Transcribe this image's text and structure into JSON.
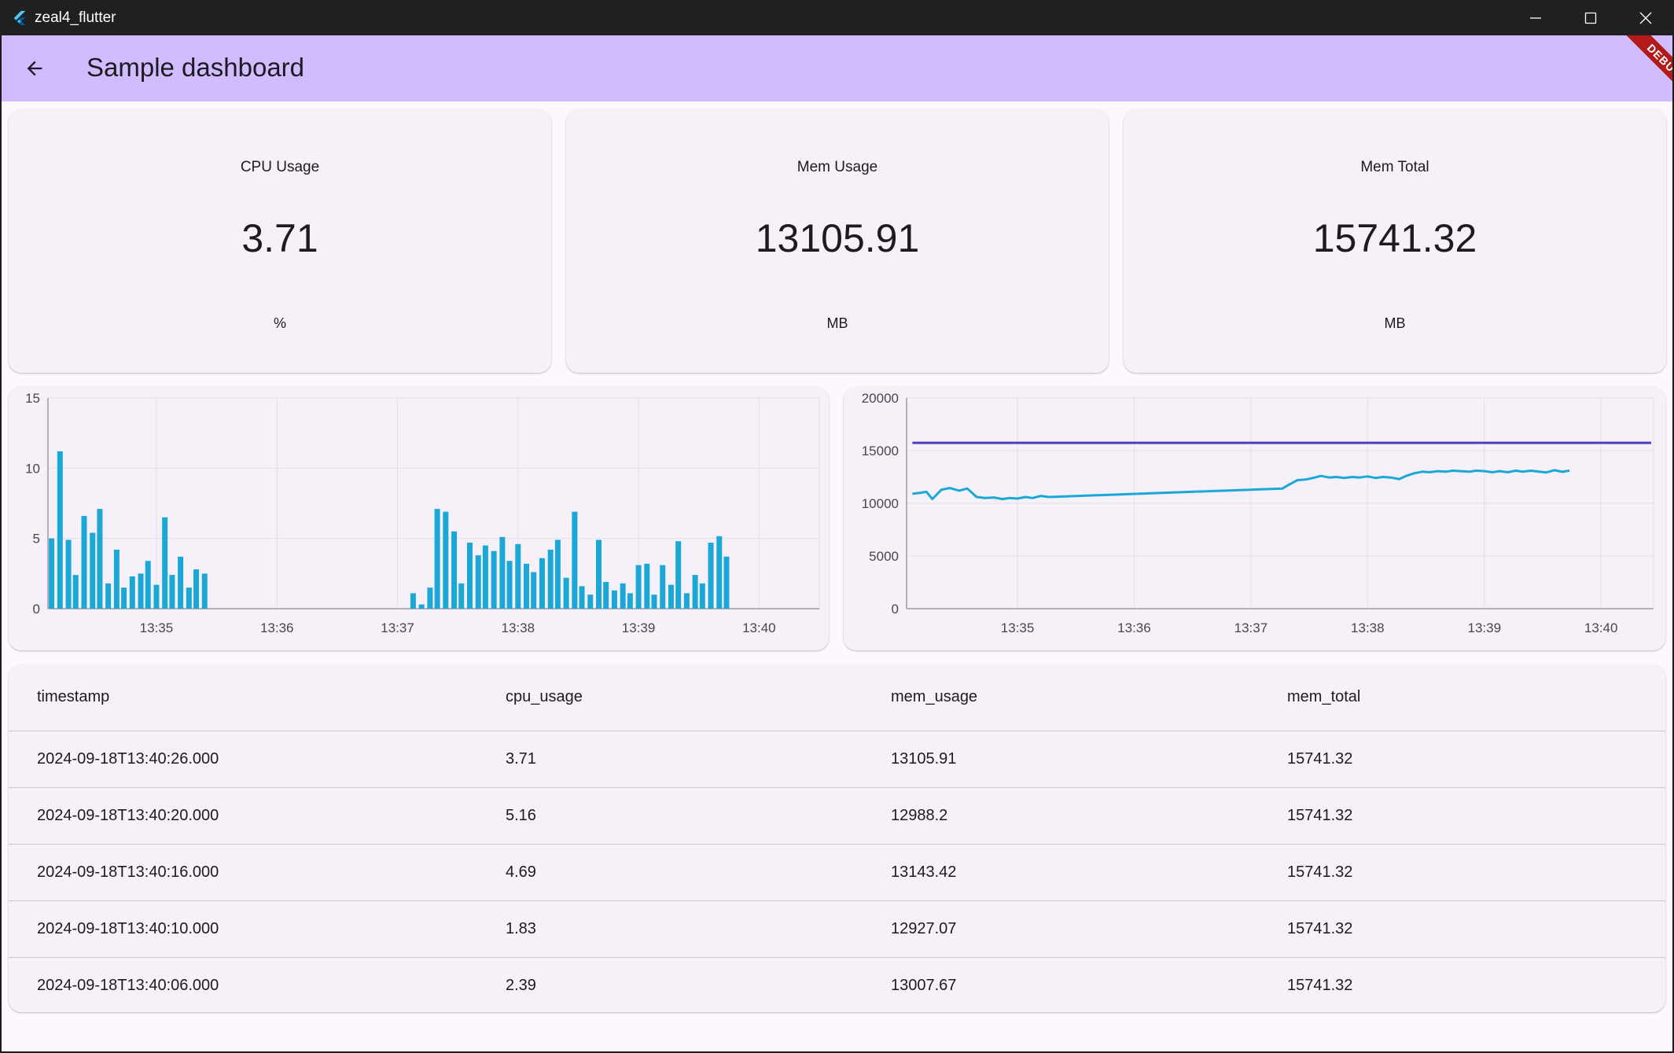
{
  "window": {
    "title": "zeal4_flutter"
  },
  "appbar": {
    "title": "Sample dashboard",
    "debug_banner": "DEBUG"
  },
  "metrics": [
    {
      "label": "CPU Usage",
      "value": "3.71",
      "unit": "%"
    },
    {
      "label": "Mem Usage",
      "value": "13105.91",
      "unit": "MB"
    },
    {
      "label": "Mem Total",
      "value": "15741.32",
      "unit": "MB"
    }
  ],
  "colors": {
    "appbar": "#d1bcff",
    "cpu_bar": "#1ba8d6",
    "mem_usage_line": "#1ba8d6",
    "mem_total_line": "#4a3fb8"
  },
  "chart_data": [
    {
      "type": "bar",
      "x_unit": "minutes",
      "x_range": [
        34.1,
        40.5
      ],
      "ylim": [
        0,
        15
      ],
      "yticks": [
        0,
        5,
        10,
        15
      ],
      "xticks": [
        {
          "label": "13:35",
          "x": 35
        },
        {
          "label": "13:36",
          "x": 36
        },
        {
          "label": "13:37",
          "x": 37
        },
        {
          "label": "13:38",
          "x": 38
        },
        {
          "label": "13:39",
          "x": 39
        },
        {
          "label": "13:40",
          "x": 40
        }
      ],
      "grid": true,
      "points": [
        [
          34.13,
          5.0
        ],
        [
          34.2,
          11.2
        ],
        [
          34.27,
          4.9
        ],
        [
          34.33,
          2.4
        ],
        [
          34.4,
          6.6
        ],
        [
          34.47,
          5.4
        ],
        [
          34.53,
          7.1
        ],
        [
          34.6,
          1.8
        ],
        [
          34.67,
          4.2
        ],
        [
          34.73,
          1.5
        ],
        [
          34.8,
          2.3
        ],
        [
          34.87,
          2.5
        ],
        [
          34.93,
          3.4
        ],
        [
          35.0,
          1.7
        ],
        [
          35.07,
          6.5
        ],
        [
          35.13,
          2.4
        ],
        [
          35.2,
          3.7
        ],
        [
          35.27,
          1.5
        ],
        [
          35.33,
          2.8
        ],
        [
          35.4,
          2.5
        ],
        [
          37.13,
          1.1
        ],
        [
          37.2,
          0.3
        ],
        [
          37.27,
          1.5
        ],
        [
          37.33,
          7.1
        ],
        [
          37.4,
          6.9
        ],
        [
          37.47,
          5.5
        ],
        [
          37.53,
          1.8
        ],
        [
          37.6,
          4.7
        ],
        [
          37.67,
          3.8
        ],
        [
          37.73,
          4.5
        ],
        [
          37.8,
          4.1
        ],
        [
          37.87,
          5.1
        ],
        [
          37.93,
          3.4
        ],
        [
          38.0,
          4.6
        ],
        [
          38.07,
          3.2
        ],
        [
          38.13,
          2.6
        ],
        [
          38.2,
          3.6
        ],
        [
          38.27,
          4.2
        ],
        [
          38.33,
          4.9
        ],
        [
          38.4,
          2.2
        ],
        [
          38.47,
          6.9
        ],
        [
          38.53,
          1.6
        ],
        [
          38.6,
          1.0
        ],
        [
          38.67,
          4.9
        ],
        [
          38.73,
          1.9
        ],
        [
          38.8,
          1.3
        ],
        [
          38.87,
          1.8
        ],
        [
          38.93,
          1.1
        ],
        [
          39.0,
          3.1
        ],
        [
          39.07,
          3.2
        ],
        [
          39.13,
          1.0
        ],
        [
          39.2,
          3.1
        ],
        [
          39.27,
          1.7
        ],
        [
          39.33,
          4.8
        ],
        [
          39.4,
          1.1
        ],
        [
          39.47,
          2.4
        ],
        [
          39.53,
          1.8
        ],
        [
          39.6,
          4.7
        ],
        [
          39.67,
          5.16
        ],
        [
          39.73,
          3.71
        ]
      ]
    },
    {
      "type": "line",
      "x_unit": "minutes",
      "x_range": [
        34.05,
        40.45
      ],
      "ylim": [
        0,
        20000
      ],
      "yticks": [
        0,
        5000,
        10000,
        15000,
        20000
      ],
      "xticks": [
        {
          "label": "13:35",
          "x": 35
        },
        {
          "label": "13:36",
          "x": 36
        },
        {
          "label": "13:37",
          "x": 37
        },
        {
          "label": "13:38",
          "x": 38
        },
        {
          "label": "13:39",
          "x": 39
        },
        {
          "label": "13:40",
          "x": 40
        }
      ],
      "grid": true,
      "series": [
        {
          "key": "mem_total",
          "points": [
            [
              34.1,
              15741.32
            ],
            [
              40.43,
              15741.32
            ]
          ]
        },
        {
          "key": "mem_usage",
          "points": [
            [
              34.1,
              10900
            ],
            [
              34.17,
              11000
            ],
            [
              34.22,
              11100
            ],
            [
              34.27,
              10400
            ],
            [
              34.35,
              11300
            ],
            [
              34.42,
              11450
            ],
            [
              34.5,
              11200
            ],
            [
              34.57,
              11400
            ],
            [
              34.65,
              10600
            ],
            [
              34.72,
              10500
            ],
            [
              34.8,
              10550
            ],
            [
              34.87,
              10400
            ],
            [
              34.93,
              10500
            ],
            [
              35.0,
              10450
            ],
            [
              35.07,
              10600
            ],
            [
              35.13,
              10500
            ],
            [
              35.2,
              10700
            ],
            [
              35.27,
              10600
            ],
            [
              37.27,
              11400
            ],
            [
              37.33,
              11800
            ],
            [
              37.4,
              12200
            ],
            [
              37.47,
              12250
            ],
            [
              37.53,
              12400
            ],
            [
              37.6,
              12600
            ],
            [
              37.67,
              12450
            ],
            [
              37.73,
              12500
            ],
            [
              37.8,
              12400
            ],
            [
              37.87,
              12500
            ],
            [
              37.93,
              12450
            ],
            [
              38.0,
              12550
            ],
            [
              38.07,
              12400
            ],
            [
              38.13,
              12500
            ],
            [
              38.2,
              12450
            ],
            [
              38.27,
              12300
            ],
            [
              38.33,
              12600
            ],
            [
              38.4,
              12850
            ],
            [
              38.47,
              13000
            ],
            [
              38.53,
              12950
            ],
            [
              38.6,
              13050
            ],
            [
              38.67,
              13000
            ],
            [
              38.73,
              13100
            ],
            [
              38.8,
              13050
            ],
            [
              38.87,
              13000
            ],
            [
              38.93,
              13100
            ],
            [
              39.0,
              13050
            ],
            [
              39.07,
              12950
            ],
            [
              39.13,
              13050
            ],
            [
              39.2,
              12950
            ],
            [
              39.27,
              13100
            ],
            [
              39.33,
              13000
            ],
            [
              39.4,
              13100
            ],
            [
              39.47,
              13007.67
            ],
            [
              39.53,
              12927.07
            ],
            [
              39.6,
              13143.42
            ],
            [
              39.67,
              12988.2
            ],
            [
              39.73,
              13105.91
            ]
          ]
        }
      ]
    }
  ],
  "table": {
    "columns": [
      "timestamp",
      "cpu_usage",
      "mem_usage",
      "mem_total"
    ],
    "rows": [
      [
        "2024-09-18T13:40:26.000",
        "3.71",
        "13105.91",
        "15741.32"
      ],
      [
        "2024-09-18T13:40:20.000",
        "5.16",
        "12988.2",
        "15741.32"
      ],
      [
        "2024-09-18T13:40:16.000",
        "4.69",
        "13143.42",
        "15741.32"
      ],
      [
        "2024-09-18T13:40:10.000",
        "1.83",
        "12927.07",
        "15741.32"
      ],
      [
        "2024-09-18T13:40:06.000",
        "2.39",
        "13007.67",
        "15741.32"
      ]
    ]
  }
}
